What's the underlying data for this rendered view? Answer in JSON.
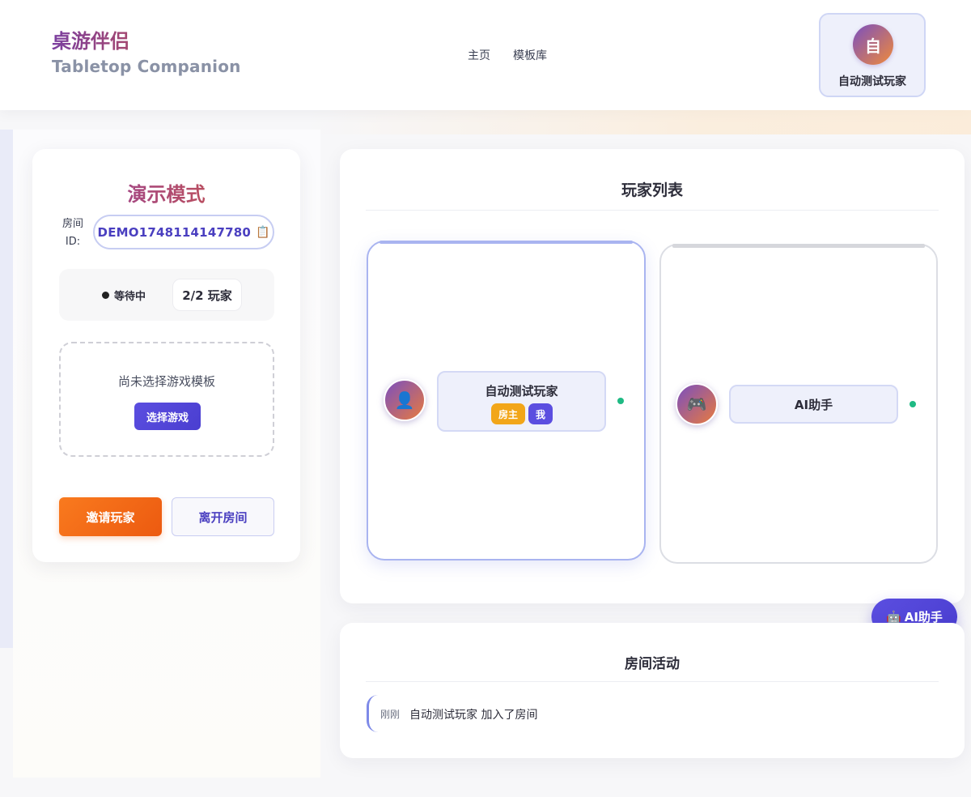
{
  "brand": {
    "cn": "桌游伴侣",
    "en": "Tabletop Companion"
  },
  "nav": {
    "items": [
      "主页",
      "模板库"
    ]
  },
  "user": {
    "avatar_text": "自",
    "name": "自动测试玩家"
  },
  "room": {
    "mode_title": "演示模式",
    "id_label": "房间 ID:",
    "id_value": "DEMO1748114147780",
    "copy_icon": "📋",
    "status": "等待中",
    "player_count": "2/2 玩家",
    "template_placeholder": "尚未选择游戏模板",
    "select_game_label": "选择游戏",
    "invite_label": "邀请玩家",
    "leave_label": "离开房间"
  },
  "players": {
    "title": "玩家列表",
    "list": [
      {
        "name": "自动测试玩家",
        "avatar_icon": "👤",
        "badges": [
          "房主",
          "我"
        ],
        "online": true
      },
      {
        "name": "AI助手",
        "avatar_icon": "🎮",
        "badges": [],
        "online": true
      }
    ]
  },
  "ai_fab": {
    "icon": "🤖",
    "label": "AI助手"
  },
  "activity": {
    "title": "房间活动",
    "items": [
      {
        "time": "刚刚",
        "text": "自动测试玩家 加入了房间"
      }
    ]
  },
  "colors": {
    "primary": "#5b4ee0",
    "accent_orange": "#f97a1e",
    "host_badge": "#f2a619",
    "online": "#1fba84"
  }
}
